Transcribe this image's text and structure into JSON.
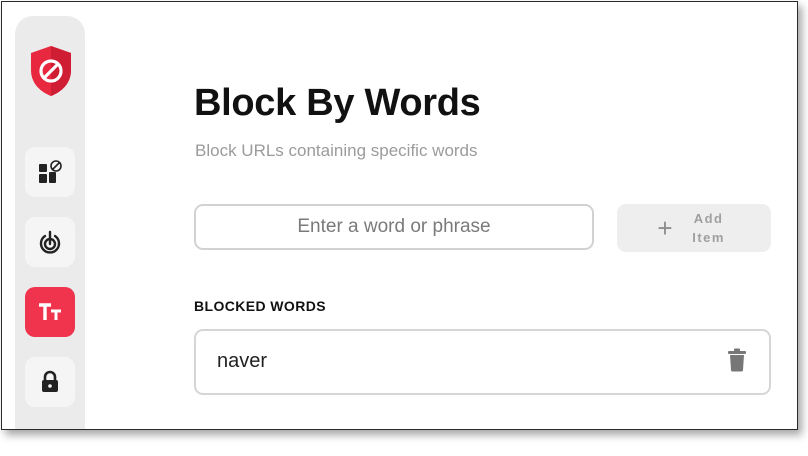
{
  "sidebar": {
    "logo_icon": "shield-block-icon",
    "items": [
      {
        "icon": "block-apps-icon",
        "active": false
      },
      {
        "icon": "focus-target-icon",
        "active": false
      },
      {
        "icon": "text-size-icon",
        "active": true
      },
      {
        "icon": "lock-icon",
        "active": false
      }
    ]
  },
  "main": {
    "title": "Block By Words",
    "subtitle": "Block URLs containing specific words",
    "input": {
      "placeholder": "Enter a word or phrase",
      "value": ""
    },
    "add_button": {
      "plus": "+",
      "label": "Add Item"
    },
    "section_title": "BLOCKED WORDS",
    "blocked_words": [
      {
        "word": "naver",
        "delete_icon": "trash-icon"
      }
    ]
  },
  "colors": {
    "accent": "#f0344d",
    "sidebar_bg": "#ebebeb",
    "muted_text": "#9b9b9b"
  }
}
